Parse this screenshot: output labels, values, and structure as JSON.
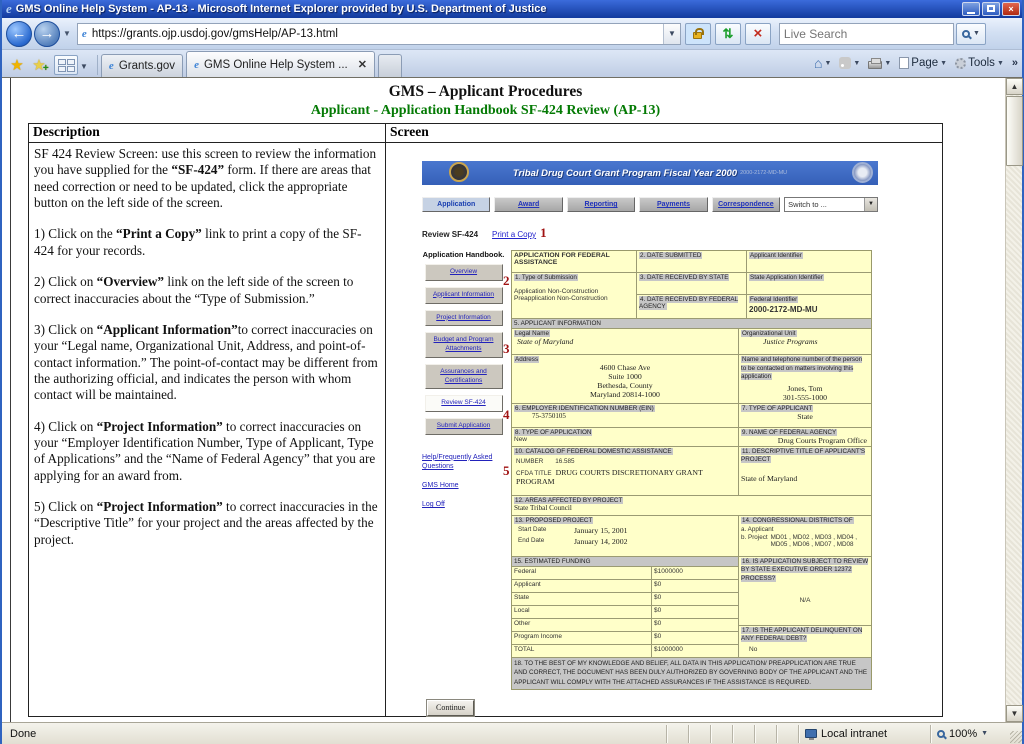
{
  "chrome": {
    "title": "GMS Online Help System - AP-13 - Microsoft Internet Explorer provided by U.S. Department of Justice",
    "url": "https://grants.ojp.usdoj.gov/gmsHelp/AP-13.html",
    "search_placeholder": "Live Search",
    "tab1": "Grants.gov",
    "tab2": "GMS Online Help System ...",
    "menu_page": "Page",
    "menu_tools": "Tools",
    "status_done": "Done",
    "status_zone": "Local intranet",
    "status_zoom": "100%"
  },
  "page": {
    "title": "GMS – Applicant Procedures",
    "subtitle": "Applicant - Application Handbook SF-424 Review (AP-13)",
    "col1": "Description",
    "col2": "Screen",
    "paragraphs": [
      [
        "SF 424 Review Screen: use this screen to review the information you have supplied for the ",
        "“SF-424”",
        " form.   If there are areas that need correction or need to be updated, click the appropriate button on the left side of the screen."
      ],
      [
        "1) Click on the ",
        "“Print a Copy”",
        " link to print a copy of the SF-424 for your records."
      ],
      [
        "2) Click on ",
        "“Overview”",
        " link on the left side of the screen to correct inaccuracies about the “Type of Submission.”"
      ],
      [
        "3) Click on ",
        "“Applicant Information”",
        "to correct inaccuracies on your “Legal name, Organizational Unit, Address, and point-of-contact information.”  The point-of-contact may be different from the authorizing official, and indicates the person with whom contact will be maintained."
      ],
      [
        "4) Click on ",
        "“Project Information”",
        " to correct inaccuracies on your “Employer Identification Number, Type of Applicant, Type of Applications” and the “Name of Federal Agency” that you are applying for an award from."
      ],
      [
        "5) Click on ",
        "“Project Information”",
        " to correct inaccuracies in the “Descriptive Title” for your project and the areas affected by the project."
      ]
    ]
  },
  "app": {
    "banner_title": "Tribal Drug Court Grant Program Fiscal Year 2000",
    "banner_code": "2000-2172-MD-MU",
    "nav": [
      "Application",
      "Award",
      "Reporting",
      "Payments",
      "Correspondence"
    ],
    "switch_label": "Switch to ...",
    "review_label": "Review SF-424",
    "print_link": "Print a Copy",
    "callouts": [
      "1",
      "2",
      "3",
      "4",
      "5"
    ],
    "sidebar": {
      "header": "Application Handbook.",
      "buttons": [
        "Overview",
        "Applicant Information",
        "Project Information",
        "Budget and Program Attachments",
        "Assurances and Certifications",
        "Review SF-424",
        "Submit Application"
      ],
      "links": [
        "Help/Frequently Asked Questions",
        "GMS Home",
        "Log Off"
      ]
    },
    "form": {
      "f0_title": "APPLICATION FOR FEDERAL ASSISTANCE",
      "f2_label": "2. DATE SUBMITTED",
      "applicant_id_label": "Applicant Identifier",
      "f1_label": "1. Type of Submission",
      "f1_value1": "Application Non-Construction",
      "f1_value2": "Preapplication Non-Construction",
      "f3_label": "3. DATE RECEIVED BY STATE",
      "state_id_label": "State Application Identifier",
      "f4_label": "4. DATE RECEIVED BY FEDERAL AGENCY",
      "federal_id_label": "Federal Identifier",
      "federal_id_value": "2000-2172-MD-MU",
      "f5_label": "5. APPLICANT INFORMATION",
      "legal_name_label": "Legal Name",
      "legal_name": "State of Maryland",
      "org_unit_label": "Organizational Unit",
      "org_unit": "Justice Programs",
      "address_label": "Address",
      "address_lines": [
        "4600 Chase Ave",
        "Suite 1000",
        "Bethesda, County",
        "Maryland 20814-1000"
      ],
      "contact_label": "Name and telephone number of the person to be contacted on matters involving this application",
      "contact_name": "Jones, Tom",
      "contact_phone": "301-555-1000",
      "f6_label": "6. EMPLOYER IDENTIFICATION NUMBER (EIN)",
      "ein": "75-3750105",
      "f7_label": "7. TYPE OF APPLICANT",
      "applicant_type": "State",
      "f8_label": "8. TYPE OF APPLICATION",
      "application_type": "New",
      "f9_label": "9. NAME OF FEDERAL AGENCY",
      "federal_agency": "Drug Courts Program Office",
      "f10_label": "10. CATALOG OF FEDERAL DOMESTIC ASSISTANCE",
      "cfda_number_label": "NUMBER",
      "cfda_number": "16.585",
      "cfda_title_label": "CFDA TITLE",
      "cfda_title": "DRUG COURTS DISCRETIONARY GRANT PROGRAM",
      "f11_label": "11. DESCRIPTIVE TITLE OF APPLICANT'S PROJECT",
      "project_title": "State of Maryland",
      "f12_label": "12. AREAS AFFECTED BY PROJECT",
      "areas_affected": "State Tribal Council",
      "f13_label": "13. PROPOSED PROJECT",
      "start_date_label": "Start Date",
      "start_date": "January 15, 2001",
      "end_date_label": "End Date",
      "end_date": "January 14, 2002",
      "f14_label": "14. CONGRESSIONAL DISTRICTS OF",
      "districts_a_label": "a. Applicant",
      "districts_b_label": "b. Project",
      "districts_b": "MD01 , MD02 , MD03 , MD04 , MD05 , MD06 , MD07 , MD08",
      "f15_label": "15. ESTIMATED FUNDING",
      "funding": [
        [
          "Federal",
          "$1000000"
        ],
        [
          "Applicant",
          "$0"
        ],
        [
          "State",
          "$0"
        ],
        [
          "Local",
          "$0"
        ],
        [
          "Other",
          "$0"
        ],
        [
          "Program Income",
          "$0"
        ],
        [
          "TOTAL",
          "$1000000"
        ]
      ],
      "f16_label": "16. IS APPLICATION SUBJECT TO REVIEW BY STATE EXECUTIVE ORDER 12372 PROCESS?",
      "f16_value": "N/A",
      "f17_label": "17. IS THE APPLICANT DELINQUENT ON ANY FEDERAL DEBT?",
      "f17_value": "No",
      "f18_label": "18. TO THE BEST OF MY KNOWLEDGE AND BELIEF, ALL DATA IN THIS APPLICATION/ PREAPPLICATION ARE TRUE AND CORRECT, THE DOCUMENT HAS BEEN DULY AUTHORIZED BY GOVERNING BODY OF THE APPLICANT AND THE APPLICANT WILL COMPLY WITH THE ATTACHED ASSURANCES IF THE ASSISTANCE IS REQUIRED."
    },
    "continue_label": "Continue"
  }
}
